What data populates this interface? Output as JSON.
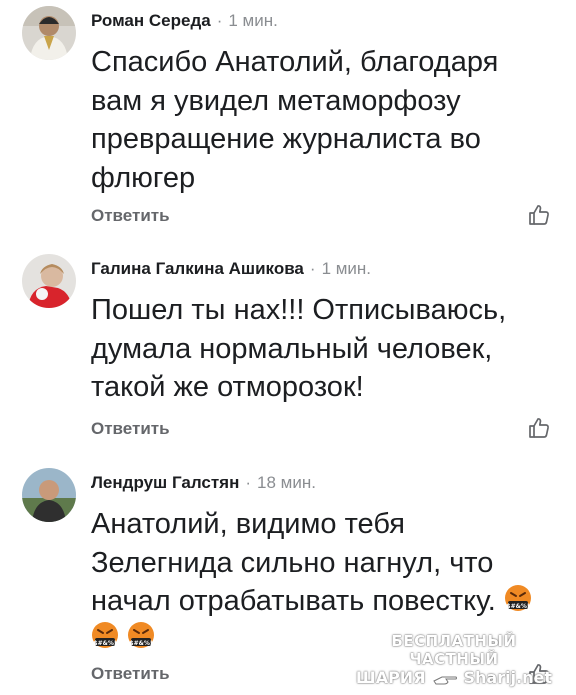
{
  "comments": [
    {
      "author": "Роман Середа",
      "dot": "·",
      "time": "1 мин.",
      "lines": [
        "Спасибо Анатолий, благодаря",
        "вам я увидел метаморфозу",
        "превращение журналиста во",
        "флюгер"
      ],
      "reply": "Ответить",
      "like_icon": "thumbs-up-outline-icon"
    },
    {
      "author": "Галина Галкина Ашикова",
      "dot": "·",
      "time": "1 мин.",
      "lines": [
        "Пошел ты нах!!! Отписываюсь,",
        "думала нормальный человек,",
        "такой же отморозок!"
      ],
      "reply": "Ответить",
      "like_icon": "thumbs-up-outline-icon"
    },
    {
      "author": "Лендруш Галстян",
      "dot": "·",
      "time": "18 мин.",
      "lines": [
        "Анатолий, видимо тебя",
        "Зелегнида сильно нагнул, что",
        "начал отрабатывать повестку."
      ],
      "emoji_icon": "face-with-symbols-on-mouth-emoji",
      "reply": "Ответить",
      "like_icon": "thumbs-up-outline-icon"
    }
  ],
  "watermark": {
    "line1": "БЕСПЛАТНЫЙ ЧАСТНЫЙ",
    "line2_left": "ШАРИЯ",
    "line2_right": "Sharij.net"
  },
  "colors": {
    "text": "#1c1e21",
    "meta_gray": "#8a8d91",
    "reply_gray": "#65676b",
    "emoji_face": "#f08a24"
  }
}
